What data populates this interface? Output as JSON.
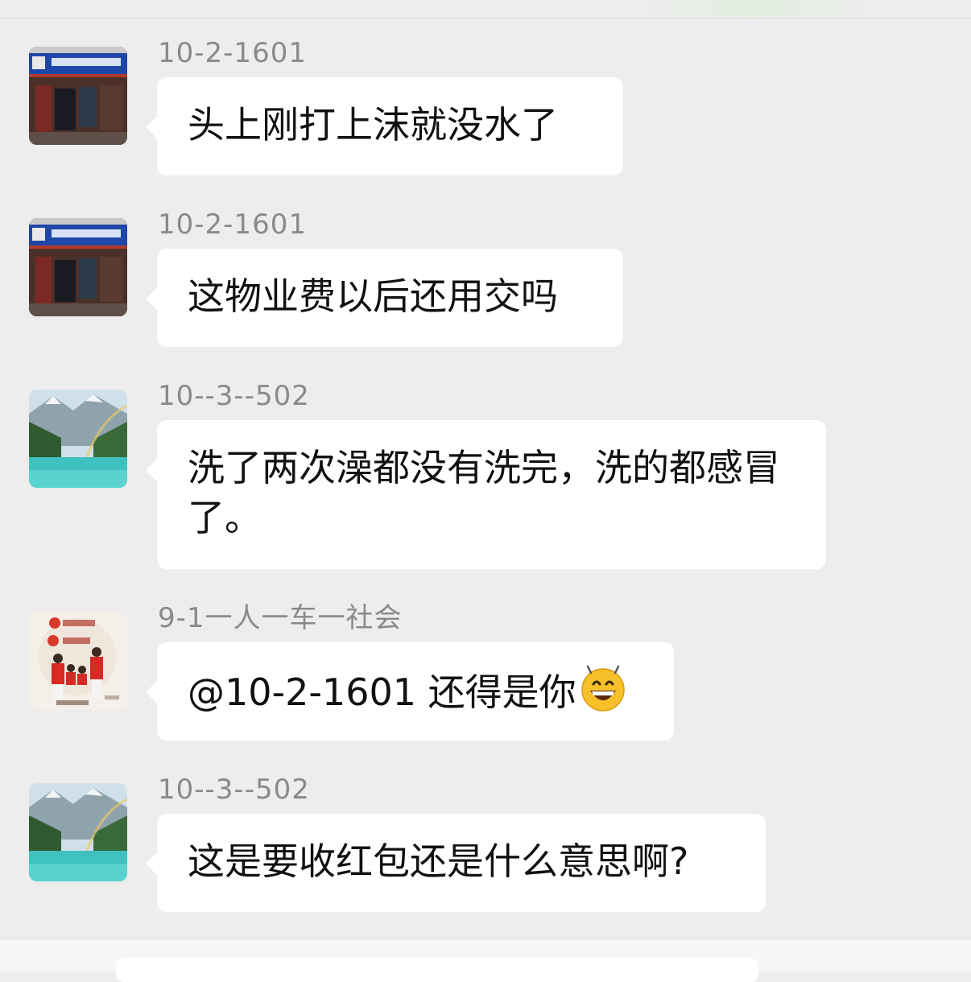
{
  "messages": [
    {
      "sender": "10-2-1601",
      "text": "头上刚打上沫就没水了",
      "avatar": "shop-avatar"
    },
    {
      "sender": "10-2-1601",
      "text": "这物业费以后还用交吗",
      "avatar": "shop-avatar"
    },
    {
      "sender": "10--3--502",
      "text": "洗了两次澡都没有洗完，洗的都感冒了。",
      "avatar": "lake-avatar"
    },
    {
      "sender": "9-1一人一车一社会",
      "text": "@10-2-1601 还得是你",
      "emoji": "grinning-face-icon",
      "avatar": "family-avatar"
    },
    {
      "sender": "10--3--502",
      "text": "这是要收红包还是什么意思啊?",
      "avatar": "lake-avatar"
    }
  ],
  "colors": {
    "background": "#ededed",
    "bubble": "#ffffff",
    "sender_text": "#8a8a8a",
    "message_text": "#111111"
  }
}
